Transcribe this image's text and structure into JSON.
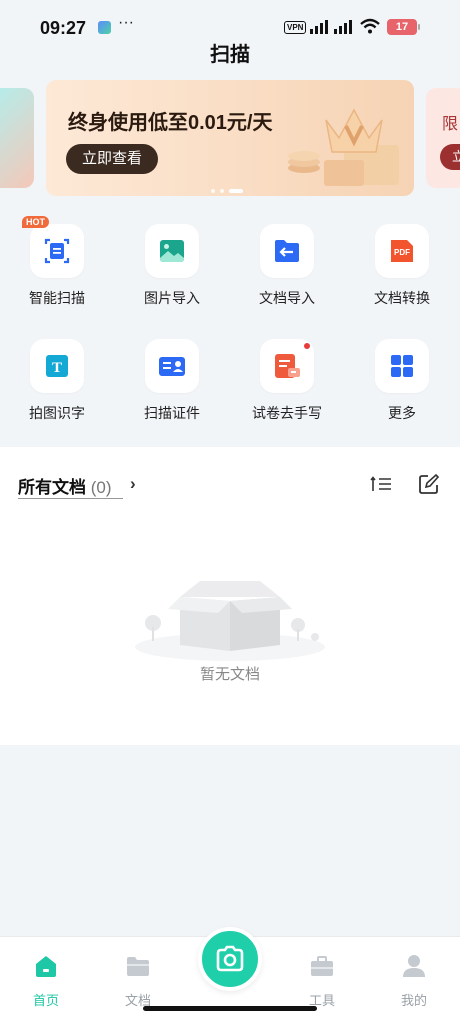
{
  "status_bar": {
    "time": "09:27",
    "dots": "···",
    "vpn": "VPN",
    "battery": "17"
  },
  "header": {
    "title": "扫描"
  },
  "banner": {
    "text": "终身使用低至0.01元/天",
    "button": "立即查看",
    "right_text": "限",
    "right_button": "立"
  },
  "tools": [
    {
      "label": "智能扫描",
      "icon": "smart-scan-icon",
      "badge": "HOT"
    },
    {
      "label": "图片导入",
      "icon": "image-import-icon"
    },
    {
      "label": "文档导入",
      "icon": "document-import-icon"
    },
    {
      "label": "文档转换",
      "icon": "pdf-convert-icon",
      "icon_text": "PDF"
    },
    {
      "label": "拍图识字",
      "icon": "text-recognition-icon",
      "icon_text": "T"
    },
    {
      "label": "扫描证件",
      "icon": "id-card-icon"
    },
    {
      "label": "试卷去手写",
      "icon": "remove-handwriting-icon"
    },
    {
      "label": "更多",
      "icon": "more-grid-icon"
    }
  ],
  "documents": {
    "title": "所有文档",
    "count": "(0)",
    "empty_text": "暂无文档"
  },
  "tabbar": {
    "tabs": [
      {
        "label": "首页",
        "icon": "home-icon",
        "active": true
      },
      {
        "label": "文档",
        "icon": "folder-icon"
      },
      {
        "label": "工具",
        "icon": "toolbox-icon"
      },
      {
        "label": "我的",
        "icon": "profile-icon"
      }
    ]
  },
  "colors": {
    "accent": "#1ec7a6",
    "banner_button": "#3b2a1f",
    "hot_badge": "#f06a3c"
  }
}
